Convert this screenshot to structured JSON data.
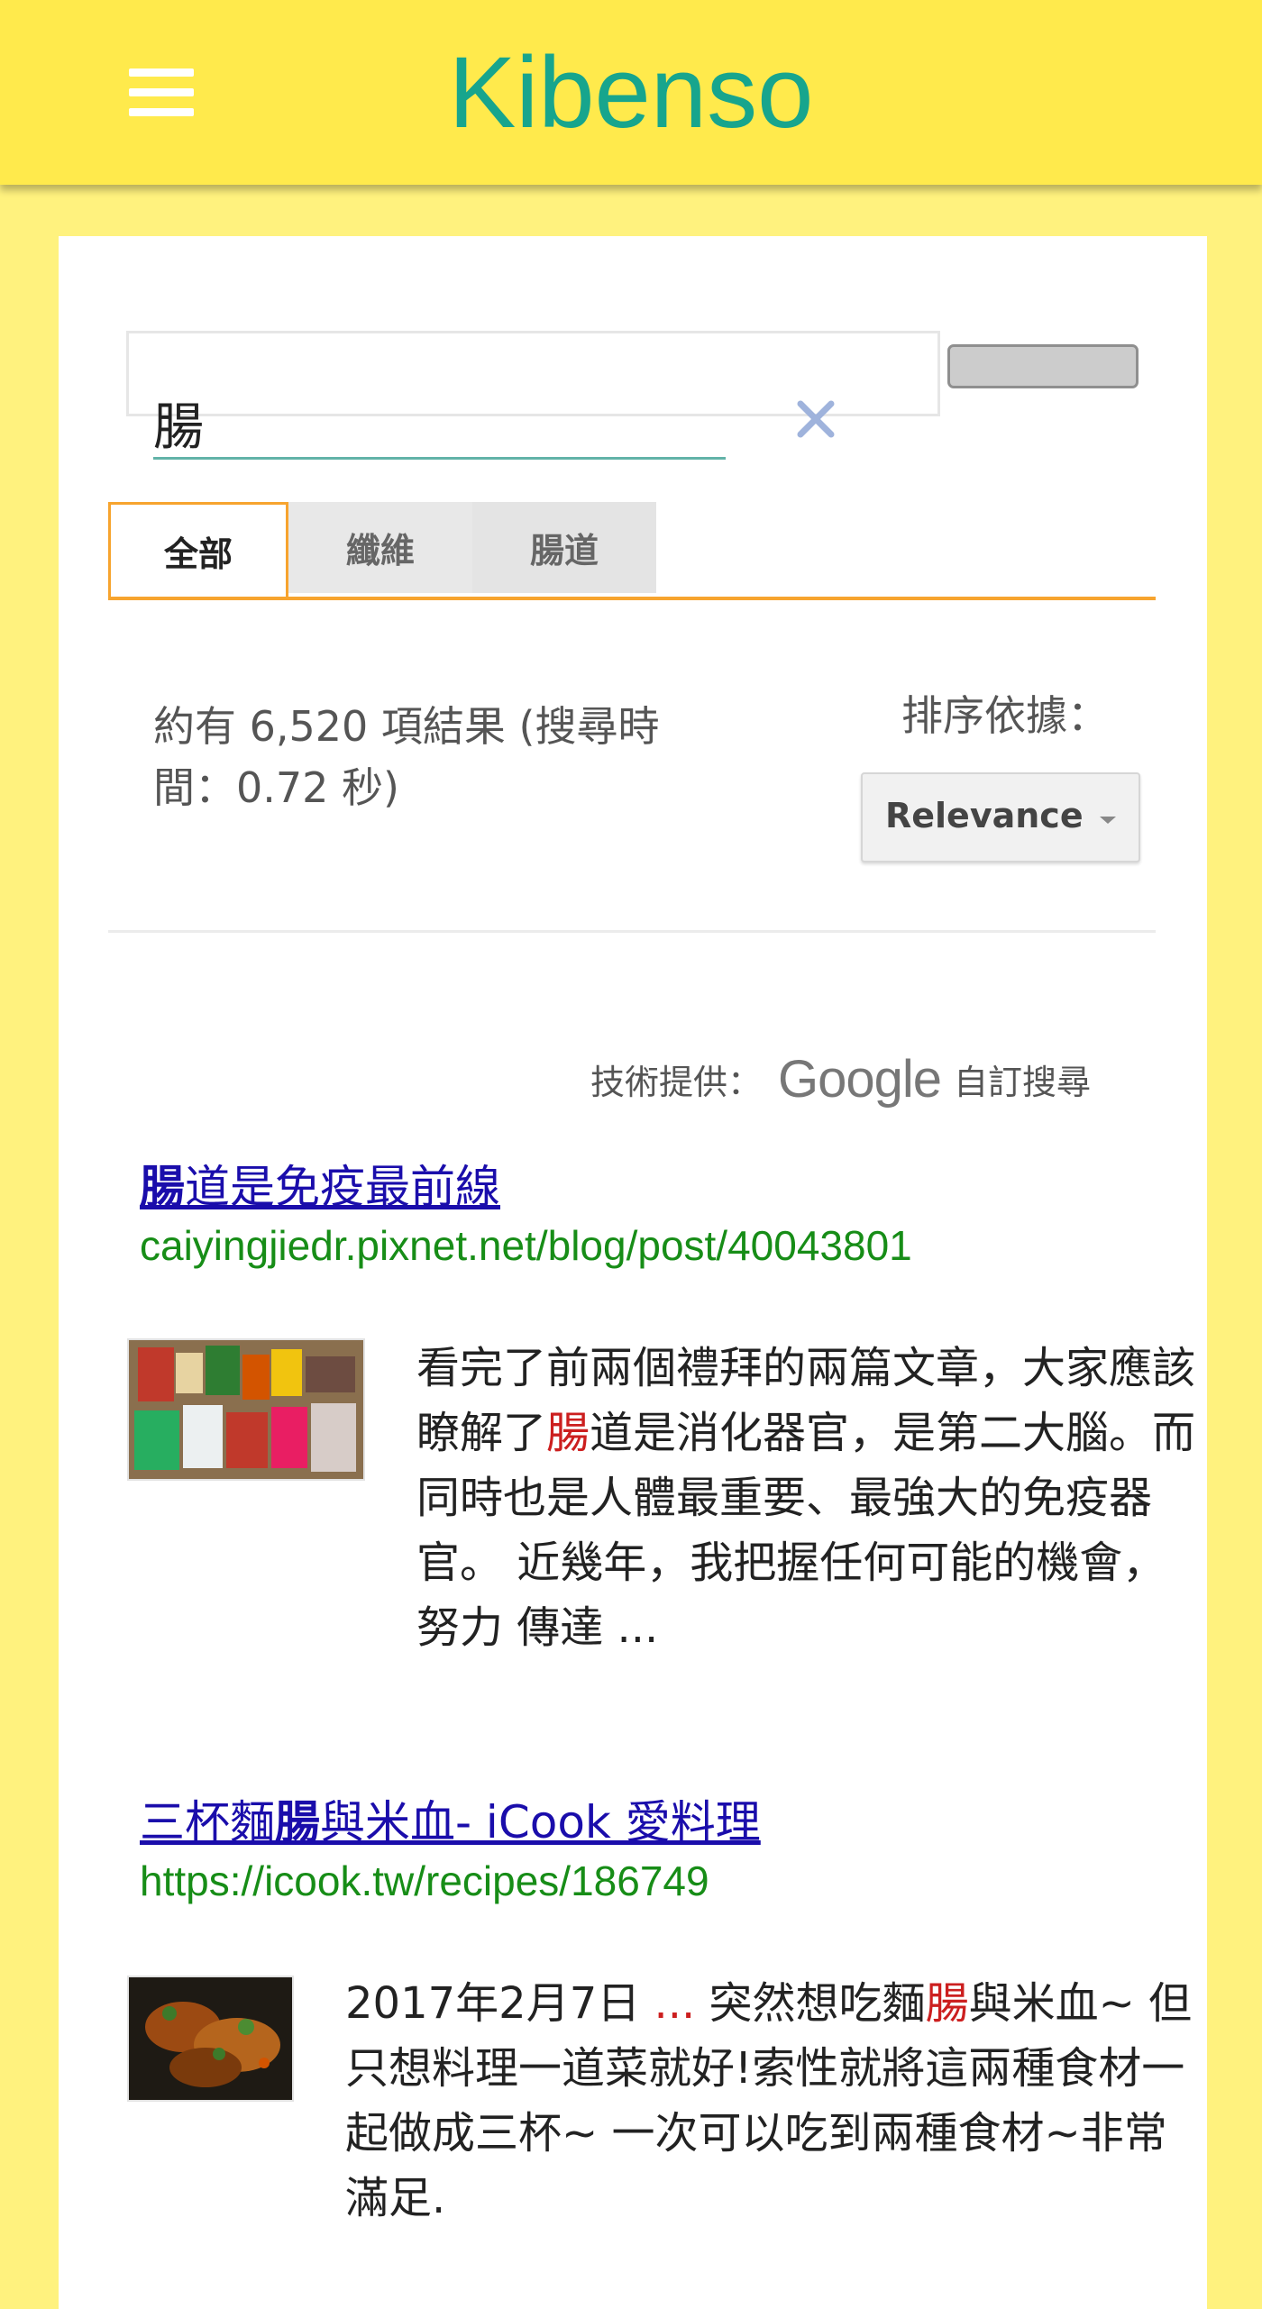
{
  "header": {
    "title": "Kibenso"
  },
  "search": {
    "value": "腸"
  },
  "tabs": [
    {
      "label": "全部"
    },
    {
      "label": "纖維"
    },
    {
      "label": "腸道"
    }
  ],
  "results_info": {
    "text": "約有 6,520 項結果 (搜尋時間：0.72 秒)",
    "sort_label": "排序依據：",
    "sort_value": "Relevance"
  },
  "powered_by": {
    "label": "技術提供：",
    "brand": "Google",
    "suffix": "自訂搜尋"
  },
  "results": [
    {
      "title_highlight": "腸",
      "title_rest": "道是免疫最前線",
      "url": "caiyingjiedr.pixnet.net/blog/post/40043801",
      "snippet_pre": "看完了前兩個禮拜的兩篇文章，大家應該瞭解了",
      "snippet_hl": "腸",
      "snippet_post": "道是消化器官，是第二大腦。而 同時也是人體最重要、最強大的免疫器官。 近幾年，我把握任何可能的機會，努力 傳達 ..."
    },
    {
      "title_pre": "三杯麵",
      "title_highlight": "腸",
      "title_rest": "與米血- iCook 愛料理",
      "url": "https://icook.tw/recipes/186749",
      "snippet_date": "2017年2月7日",
      "snippet_sep": " ... ",
      "snippet_pre": "突然想吃麵",
      "snippet_hl": "腸",
      "snippet_post": "與米血~ 但只想料理一道菜就好!索性就將這兩種食材一起做成三杯~ 一次可以吃到兩種食材~非常滿足."
    }
  ],
  "colors": {
    "header_bg": "#FFEA4C",
    "page_bg": "#FFF27E",
    "brand": "#17A58D",
    "tab_accent": "#F7A42E",
    "link": "#1a0dab",
    "url": "#178d17",
    "highlight": "#cc1f1f"
  }
}
